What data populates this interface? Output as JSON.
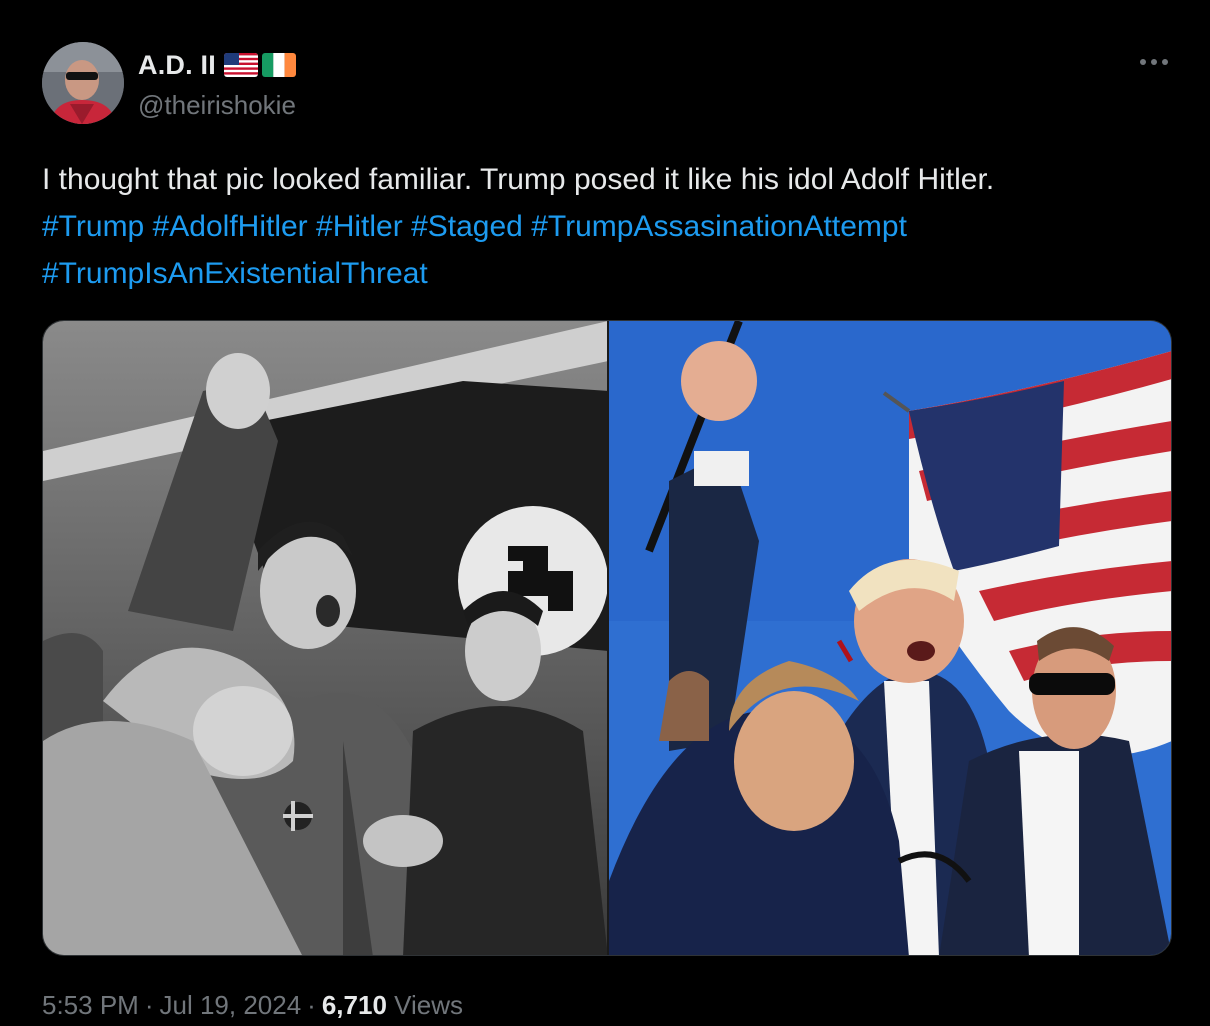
{
  "author": {
    "display_name": "A.D. II",
    "handle": "@theirishokie",
    "flags": [
      "us-flag-icon",
      "ireland-flag-icon"
    ]
  },
  "more_menu_icon": "more-horizontal-icon",
  "tweet": {
    "text": "I thought that pic looked familiar. Trump posed it like his idol Adolf Hitler.",
    "hashtags_line1": [
      "#Trump",
      "#AdolfHitler",
      "#Hitler",
      "#Staged",
      "#TrumpAssasinationAttempt"
    ],
    "hashtags_line2": [
      "#TrumpIsAnExistentialThreat"
    ]
  },
  "media": {
    "count": 2,
    "left_image": "black-and-white historical photo",
    "right_image": "color photo with american flag"
  },
  "meta": {
    "time": "5:53 PM",
    "separator": "·",
    "date": "Jul 19, 2024",
    "views_count": "6,710",
    "views_label": "Views"
  },
  "colors": {
    "background": "#000000",
    "text_primary": "#e7e9ea",
    "text_secondary": "#71767b",
    "link": "#1d9bf0",
    "border": "#2f3336"
  }
}
